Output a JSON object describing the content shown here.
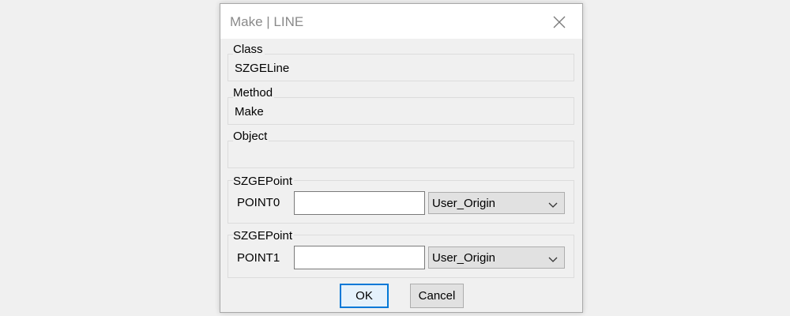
{
  "dialog": {
    "title": "Make | LINE",
    "icons": {
      "close": "close-icon",
      "dropdown": "chevron-down-icon"
    },
    "accent_color": "#0078d7"
  },
  "groups": {
    "class": {
      "label": "Class",
      "value": "SZGELine"
    },
    "method": {
      "label": "Method",
      "value": "Make"
    },
    "object": {
      "label": "Object",
      "value": ""
    }
  },
  "points": [
    {
      "group_label": "SZGEPoint",
      "row_label": "POINT0",
      "input_value": "",
      "select_value": "User_Origin"
    },
    {
      "group_label": "SZGEPoint",
      "row_label": "POINT1",
      "input_value": "",
      "select_value": "User_Origin"
    }
  ],
  "buttons": {
    "ok_label": "OK",
    "cancel_label": "Cancel"
  }
}
